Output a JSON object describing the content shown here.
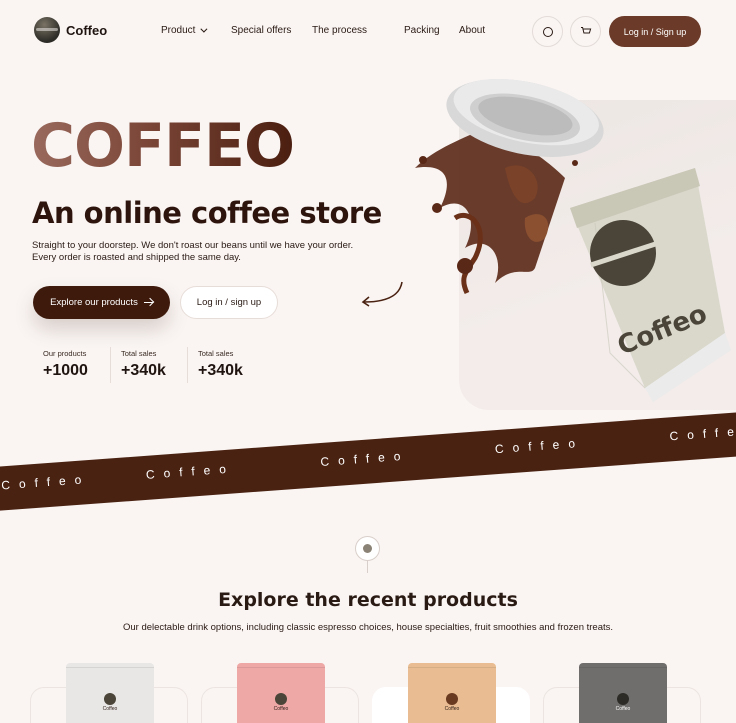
{
  "brand": {
    "name": "Coffeo"
  },
  "nav": {
    "items": [
      {
        "label": "Product",
        "has_dropdown": true
      },
      {
        "label": "Special offers"
      },
      {
        "label": "The process"
      },
      {
        "label": "Packing"
      },
      {
        "label": "About"
      }
    ],
    "login_label": "Log in / Sign up",
    "icons": [
      "search-icon",
      "cart-icon"
    ]
  },
  "hero": {
    "title": "COFFEO",
    "subtitle": "An online coffee store",
    "description": "Straight to your doorstep. We don't roast our beans until we have your order. Every order is roasted and shipped the same day.",
    "primary_button": "Explore our products",
    "secondary_button": "Log in / sign up",
    "cup_label": "Coffeo",
    "stats": [
      {
        "label": "Our products",
        "value": "+1000"
      },
      {
        "label": "Total sales",
        "value": "+340k"
      },
      {
        "label": "Total sales",
        "value": "+340k"
      }
    ]
  },
  "band": {
    "text": "Coffeo"
  },
  "products_section": {
    "title": "Explore the recent products",
    "description": "Our delectable drink options, including classic espresso choices, house specialties, fruit smoothies and frozen treats.",
    "bag_label": "Coffeo",
    "bag_colors": [
      "#e9e7e5",
      "#eea8a6",
      "#e9bd91",
      "#6f6e6c"
    ]
  },
  "colors": {
    "accent": "#6b3a28",
    "dark": "#3e1a0c",
    "band": "#4a2212",
    "background": "#faf5f3"
  }
}
